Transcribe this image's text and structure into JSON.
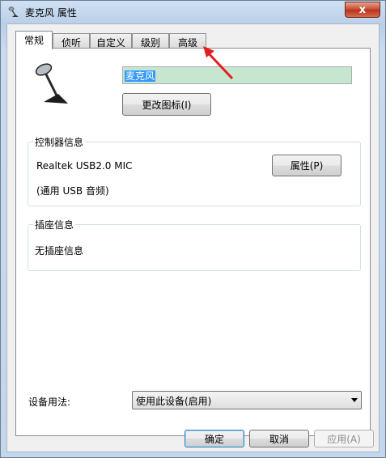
{
  "window": {
    "title": "麦克风 属性",
    "close_label": "x"
  },
  "tabs": [
    {
      "label": "常规",
      "active": true
    },
    {
      "label": "侦听",
      "active": false
    },
    {
      "label": "自定义",
      "active": false
    },
    {
      "label": "级别",
      "active": false
    },
    {
      "label": "高级",
      "active": false
    }
  ],
  "general": {
    "device_name": "麦克风",
    "change_icon_label": "更改图标(I)",
    "controller": {
      "title": "控制器信息",
      "name": "Realtek USB2.0 MIC",
      "desc": "(通用 USB 音频)",
      "properties_label": "属性(P)"
    },
    "jack": {
      "title": "插座信息",
      "text": "无插座信息"
    },
    "usage": {
      "label": "设备用法:",
      "selected": "使用此设备(启用)"
    }
  },
  "footer": {
    "ok_label": "确定",
    "cancel_label": "取消",
    "apply_label": "应用(A)"
  },
  "colors": {
    "selection": "#3399ff",
    "input_bg": "#c7e6cf",
    "annotation_arrow": "#e02020"
  }
}
